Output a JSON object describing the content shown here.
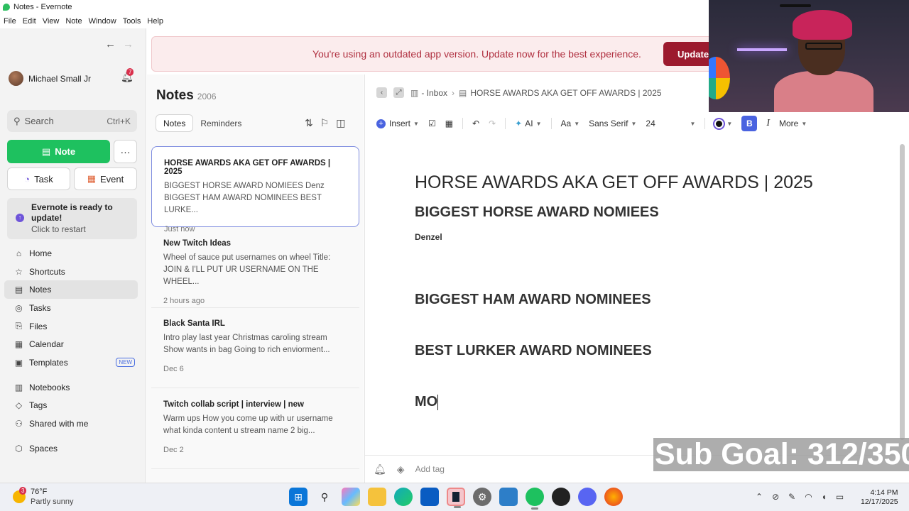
{
  "window": {
    "title": "Notes - Evernote"
  },
  "menu": [
    "File",
    "Edit",
    "View",
    "Note",
    "Window",
    "Tools",
    "Help"
  ],
  "sidebar": {
    "user_name": "Michael Small Jr",
    "notification_count": "7",
    "search_placeholder": "Search",
    "search_shortcut": "Ctrl+K",
    "new_note_label": "Note",
    "more_label": "···",
    "task_label": "Task",
    "event_label": "Event",
    "update_title": "Evernote is ready to update!",
    "update_subtitle": "Click to restart",
    "nav": [
      {
        "label": "Home",
        "icon": "home-icon"
      },
      {
        "label": "Shortcuts",
        "icon": "star-icon"
      },
      {
        "label": "Notes",
        "icon": "notes-icon"
      },
      {
        "label": "Tasks",
        "icon": "check-circle-icon"
      },
      {
        "label": "Files",
        "icon": "paperclip-icon"
      },
      {
        "label": "Calendar",
        "icon": "calendar-icon"
      },
      {
        "label": "Templates",
        "icon": "template-icon",
        "badge": "NEW"
      },
      {
        "label": "Notebooks",
        "icon": "notebook-icon"
      },
      {
        "label": "Tags",
        "icon": "tag-icon"
      },
      {
        "label": "Shared with me",
        "icon": "people-icon"
      },
      {
        "label": "Spaces",
        "icon": "cube-icon"
      }
    ]
  },
  "banner": {
    "message": "You're using an outdated app version. Update now for the best experience.",
    "button": "Update"
  },
  "notelist": {
    "title": "Notes",
    "count": "2006",
    "tabs": [
      "Notes",
      "Reminders"
    ],
    "notes": [
      {
        "title": "HORSE AWARDS AKA GET OFF AWARDS | 2025",
        "line1": "BIGGEST HORSE AWARD NOMIEES Denz",
        "line2": "BIGGEST HAM AWARD NOMINEES BEST LURKE...",
        "date": "Just now"
      },
      {
        "title": "New Twitch Ideas",
        "line1": "Wheel of sauce put usernames on wheel Title:",
        "line2": "JOIN & I'LL PUT UR USERNAME ON THE WHEEL...",
        "date": "2 hours ago"
      },
      {
        "title": "Black Santa IRL",
        "line1": "Intro play last year Christmas caroling stream",
        "line2": "Show wants in bag Going to rich enviorment...",
        "date": "Dec 6"
      },
      {
        "title": "Twitch collab script | interview | new",
        "line1": "Warm ups How you come up with ur username",
        "line2": "what kinda content u stream name 2 big...",
        "date": "Dec 2"
      }
    ]
  },
  "editor": {
    "breadcrumb_notebook": "- Inbox",
    "breadcrumb_note": "HORSE AWARDS AKA GET OFF AWARDS | 2025",
    "toolbar": {
      "insert": "Insert",
      "ai": "AI",
      "font_label": "Aa",
      "font_family": "Sans Serif",
      "font_size": "24",
      "bold": "B",
      "italic": "I",
      "more": "More"
    },
    "doc": {
      "title": "HORSE AWARDS AKA GET OFF AWARDS | 2025",
      "h2_1": "BIGGEST HORSE AWARD NOMIEES",
      "p_1": "Denzel",
      "h2_2": "BIGGEST HAM AWARD NOMINEES",
      "h2_3": "BEST LURKER AWARD NOMINEES",
      "h2_4": "MO"
    },
    "tag_placeholder": "Add tag"
  },
  "overlay": {
    "sub_goal": "Sub Goal: 312/350"
  },
  "taskbar": {
    "temperature": "76°F",
    "weather": "Partly sunny",
    "weather_badge": "3",
    "time": "4:14 PM",
    "date": "12/17/2025"
  }
}
